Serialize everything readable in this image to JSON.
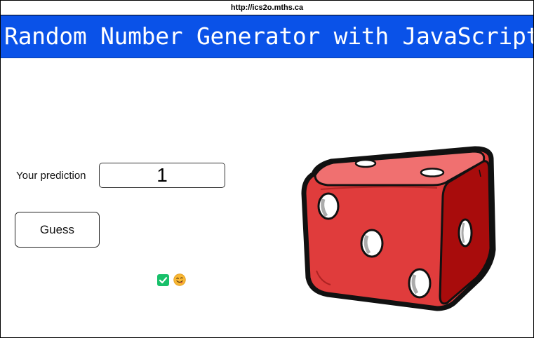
{
  "browser": {
    "url": "http://ics2o.mths.ca"
  },
  "header": {
    "title": "Random Number Generator with JavaScript"
  },
  "form": {
    "prediction_label": "Your prediction",
    "prediction_value": "1",
    "guess_label": "Guess"
  },
  "result": {
    "icons": [
      "check-mark-icon",
      "face-savoring-food-icon"
    ]
  },
  "colors": {
    "banner": "#0a52e8",
    "dice_red": "#e03c3c",
    "check_green": "#18c06a"
  },
  "dice": {
    "icon": "red-die-icon"
  }
}
